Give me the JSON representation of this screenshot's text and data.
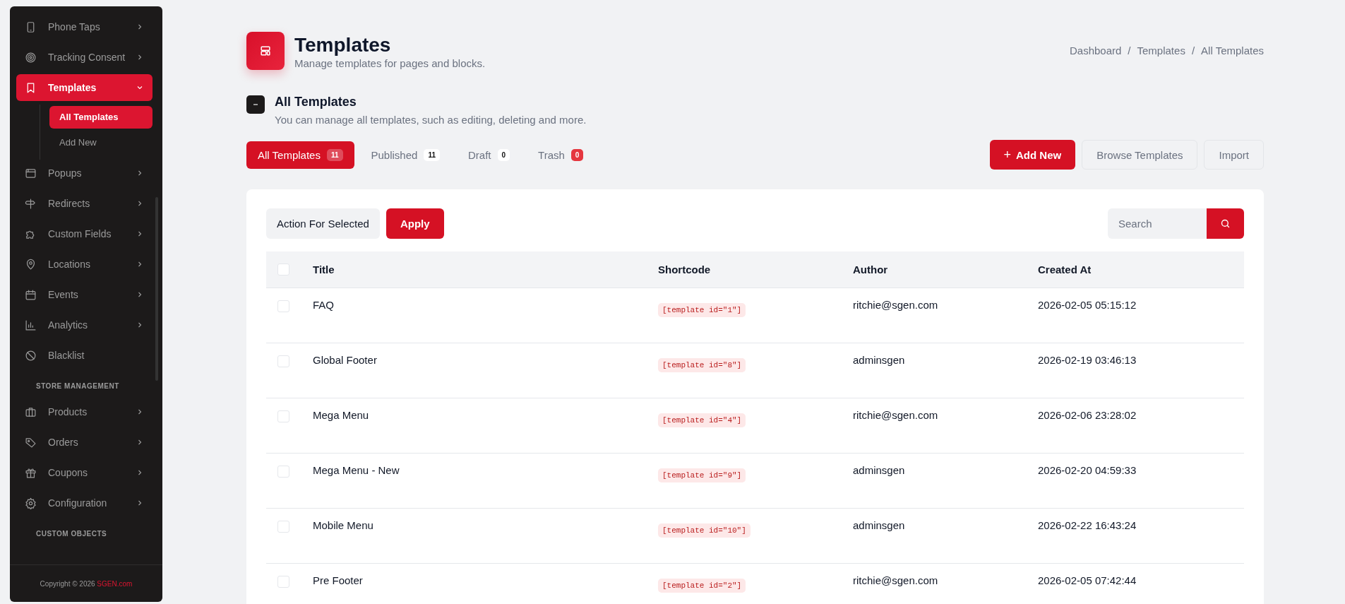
{
  "sidebar": {
    "groups": [
      {
        "items": [
          {
            "label": "Phone Taps",
            "expandable": true,
            "expanded": false,
            "selected": false
          },
          {
            "label": "Tracking Consent",
            "expandable": true,
            "expanded": false,
            "selected": false
          },
          {
            "label": "Templates",
            "expandable": true,
            "expanded": true,
            "selected": true,
            "children": [
              {
                "label": "All Templates",
                "selected": true
              },
              {
                "label": "Add New",
                "selected": false
              }
            ]
          },
          {
            "label": "Popups",
            "expandable": true,
            "expanded": false,
            "selected": false
          },
          {
            "label": "Redirects",
            "expandable": true,
            "expanded": false,
            "selected": false
          },
          {
            "label": "Custom Fields",
            "expandable": true,
            "expanded": false,
            "selected": false
          },
          {
            "label": "Locations",
            "expandable": true,
            "expanded": false,
            "selected": false
          },
          {
            "label": "Events",
            "expandable": true,
            "expanded": false,
            "selected": false
          },
          {
            "label": "Analytics",
            "expandable": true,
            "expanded": false,
            "selected": false
          },
          {
            "label": "Blacklist",
            "expandable": false,
            "selected": false
          }
        ]
      },
      {
        "heading": "STORE MANAGEMENT",
        "items": [
          {
            "label": "Products",
            "expandable": true,
            "expanded": false,
            "selected": false
          },
          {
            "label": "Orders",
            "expandable": true,
            "expanded": false,
            "selected": false
          },
          {
            "label": "Coupons",
            "expandable": true,
            "expanded": false,
            "selected": false
          },
          {
            "label": "Configuration",
            "expandable": true,
            "expanded": false,
            "selected": false
          }
        ]
      },
      {
        "heading": "CUSTOM OBJECTS"
      }
    ],
    "footer": {
      "text": "Copyright © 2026",
      "link": "SGEN.com"
    }
  },
  "header": {
    "title": "Templates",
    "subtitle": "Manage templates for pages and blocks.",
    "breadcrumb": [
      "Dashboard",
      "Templates",
      "All Templates"
    ],
    "breadcrumb_separator": "/"
  },
  "section": {
    "title": "All Templates",
    "description": "You can manage all templates, such as editing, deleting and more."
  },
  "tabs": [
    {
      "label": "All Templates",
      "count": "11",
      "selected": true,
      "alert": false
    },
    {
      "label": "Published",
      "count": "11",
      "selected": false,
      "alert": false
    },
    {
      "label": "Draft",
      "count": "0",
      "selected": false,
      "alert": false
    },
    {
      "label": "Trash",
      "count": "0",
      "selected": false,
      "alert": true
    }
  ],
  "actions": [
    {
      "label": "Add New",
      "kind": "primary",
      "icon": "+"
    },
    {
      "label": "Browse Templates",
      "kind": "secondary"
    },
    {
      "label": "Import",
      "kind": "secondary"
    }
  ],
  "toolbar": {
    "bulk_action": "Action For Selected",
    "apply": "Apply",
    "search": {
      "placeholder": "Search"
    }
  },
  "table": {
    "select_all_checked": false,
    "columns": [
      "Title",
      "Shortcode",
      "Author",
      "Created At"
    ],
    "rows": [
      {
        "checked": false,
        "title": "FAQ",
        "shortcode": "[template id=\"1\"]",
        "author": "ritchie@sgen.com",
        "created_at": "2026-02-05 05:15:12"
      },
      {
        "checked": false,
        "title": "Global Footer",
        "shortcode": "[template id=\"8\"]",
        "author": "adminsgen",
        "created_at": "2026-02-19 03:46:13"
      },
      {
        "checked": false,
        "title": "Mega Menu",
        "shortcode": "[template id=\"4\"]",
        "author": "ritchie@sgen.com",
        "created_at": "2026-02-06 23:28:02"
      },
      {
        "checked": false,
        "title": "Mega Menu - New",
        "shortcode": "[template id=\"9\"]",
        "author": "adminsgen",
        "created_at": "2026-02-20 04:59:33"
      },
      {
        "checked": false,
        "title": "Mobile Menu",
        "shortcode": "[template id=\"10\"]",
        "author": "adminsgen",
        "created_at": "2026-02-22 16:43:24"
      },
      {
        "checked": false,
        "title": "Pre Footer",
        "shortcode": "[template id=\"2\"]",
        "author": "ritchie@sgen.com",
        "created_at": "2026-02-05 07:42:44"
      }
    ]
  }
}
